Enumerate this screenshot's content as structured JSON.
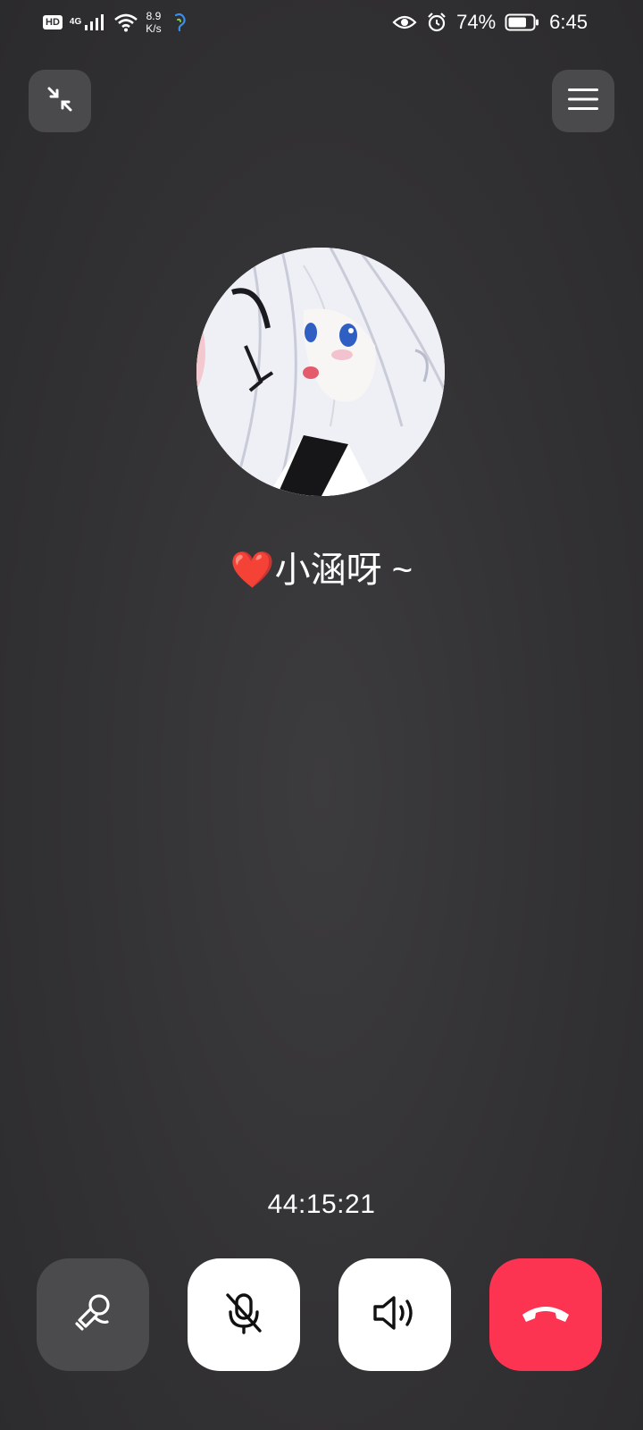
{
  "status_bar": {
    "hd": "HD",
    "network": "4G",
    "network_speed_top": "8.9",
    "network_speed_bottom": "K/s",
    "battery": "74%",
    "time": "6:45",
    "icons": [
      "hd-icon",
      "signal-icon",
      "wifi-icon",
      "phone-listen-icon",
      "eye-icon",
      "alarm-icon",
      "battery-icon"
    ]
  },
  "call": {
    "contact_heart": "❤️",
    "contact_name": "小涵呀 ~",
    "duration": "44:15:21"
  },
  "controls": {
    "minimize_icon": "minimize-icon",
    "menu_icon": "menu-icon",
    "buttons": [
      {
        "icon": "camera-switch-icon",
        "state": "inactive"
      },
      {
        "icon": "mic-off-icon",
        "state": "active"
      },
      {
        "icon": "speaker-icon",
        "state": "active"
      },
      {
        "icon": "hang-up-icon",
        "state": "danger"
      }
    ]
  },
  "colors": {
    "background": "#323133",
    "button_dark": "#4b4a4c",
    "button_light": "#ffffff",
    "hangup": "#fd3352"
  }
}
